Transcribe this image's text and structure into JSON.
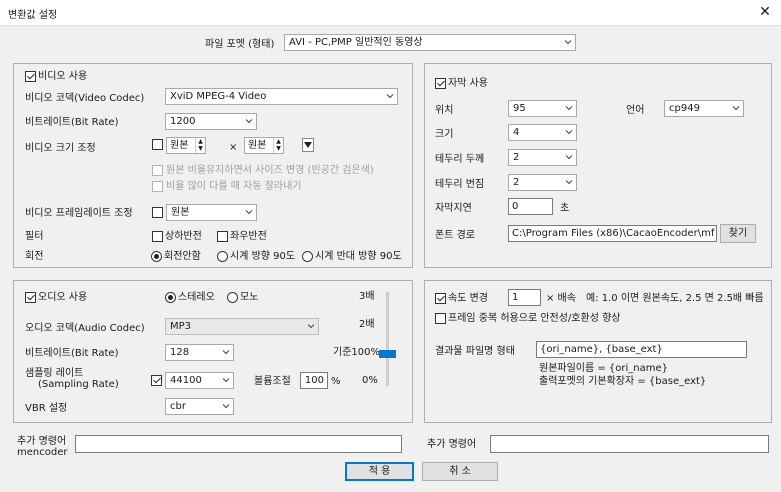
{
  "window": {
    "title": "변환값 설정",
    "close_glyph": "✕"
  },
  "format": {
    "label": "파일 포멧 (형태)",
    "value": "AVI - PC,PMP 일반적인 동영상"
  },
  "video": {
    "use_label": "비디오 사용",
    "codec_label": "비디오 코덱(Video Codec)",
    "codec_value": "XviD MPEG-4 Video",
    "bitrate_label": "비트레이트(Bit Rate)",
    "bitrate_value": "1200",
    "size_label": "비디오 크기 조정",
    "size_w": "원본",
    "size_x": "×",
    "size_h": "원본",
    "keep_ratio_label": "원본 비율유지하면서 사이즈 변경 (빈공간 검은색)",
    "auto_crop_label": "비율 많이 다를 때 자동 잘라내기",
    "framerate_label": "비디오 프레임레이트 조정",
    "framerate_value": "원본",
    "filter_label": "필터",
    "flip_v_label": "상하반전",
    "flip_h_label": "좌우반전",
    "rotate_label": "회전",
    "rotate_none_label": "회전안함",
    "rotate_cw_label": "시계 방향 90도",
    "rotate_ccw_label": "시계 반대 방향 90도"
  },
  "subtitle": {
    "use_label": "자막 사용",
    "position_label": "위치",
    "position_value": "95",
    "language_label": "언어",
    "language_value": "cp949",
    "size_label": "크기",
    "size_value": "4",
    "border_width_label": "테두리 두께",
    "border_width_value": "2",
    "border_blur_label": "테두리 번짐",
    "border_blur_value": "2",
    "delay_label": "자막지연",
    "delay_value": "0",
    "delay_unit": "초",
    "font_path_label": "폰트 경로",
    "font_path_value": "C:\\Program Files (x86)\\CacaoEncoder\\mf",
    "browse_label": "찾기"
  },
  "audio": {
    "use_label": "오디오 사용",
    "stereo_label": "스테레오",
    "mono_label": "모노",
    "codec_label": "오디오 코덱(Audio Codec)",
    "codec_value": "MP3",
    "bitrate_label": "비트레이트(Bit Rate)",
    "bitrate_value": "128",
    "sampling_label_1": "샘플링 레이트",
    "sampling_label_2": "(Sampling Rate)",
    "sampling_value": "44100",
    "volume_label": "볼륨조절",
    "volume_value": "100",
    "volume_unit": "%",
    "vbr_label": "VBR 설정",
    "vbr_value": "cbr",
    "scale_3x": "3배",
    "scale_2x": "2배",
    "scale_base": "기준100%",
    "scale_0": "0%",
    "slider_level": 0.33
  },
  "speed": {
    "change_label": "속도 변경",
    "value": "1",
    "multiplier_note": "× 배속",
    "example_note": "예: 1.0 이면 원본속도, 2.5 면 2.5배 빠름",
    "frame_dup_label": "프레임 중복 허용으로 안전성/호환성 향상",
    "output_name_label": "결과물 파일명 형태",
    "output_name_value": "{ori_name}, {base_ext}",
    "ori_name_note": "원본파일이름 = {ori_name}",
    "base_ext_note": "출력포멧의 기본확장자 = {base_ext}"
  },
  "extra": {
    "mencoder_label_1": "추가 명령어",
    "mencoder_label_2": "mencoder",
    "mencoder_value": "",
    "extra_label": "추가 명령어",
    "extra_value": ""
  },
  "buttons": {
    "ok_label": "적 용",
    "cancel_label": "취 소"
  }
}
